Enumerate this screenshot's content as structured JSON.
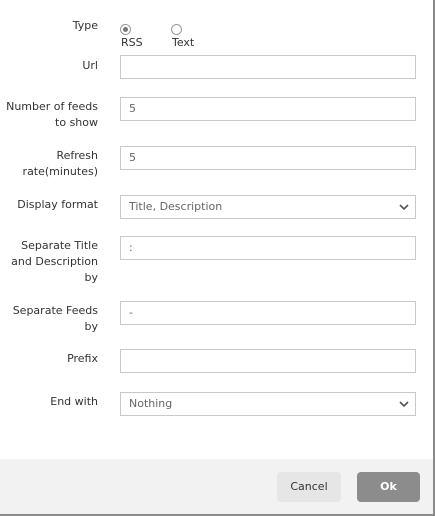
{
  "type": {
    "label": "Type",
    "options": [
      {
        "label": "RSS",
        "checked": true
      },
      {
        "label": "Text",
        "checked": false
      }
    ]
  },
  "url": {
    "label": "Url",
    "value": ""
  },
  "feeds_count": {
    "label_line1": "Number of feeds",
    "label_line2": "to show",
    "value": "5"
  },
  "refresh_rate": {
    "label_line1": "Refresh",
    "label_line2": "rate(minutes)",
    "value": "5"
  },
  "display_format": {
    "label": "Display format",
    "value": "Title, Description",
    "icon": "chevron-down-icon"
  },
  "separate_title": {
    "label_line1": "Separate Title",
    "label_line2": "and Description",
    "label_line3": "by",
    "value": ":"
  },
  "separate_feeds": {
    "label_line1": "Separate Feeds",
    "label_line2": "by",
    "value": "-"
  },
  "prefix": {
    "label": "Prefix",
    "value": ""
  },
  "end_with": {
    "label": "End with",
    "value": "Nothing",
    "icon": "chevron-down-icon"
  },
  "buttons": {
    "cancel": "Cancel",
    "ok": "Ok"
  }
}
